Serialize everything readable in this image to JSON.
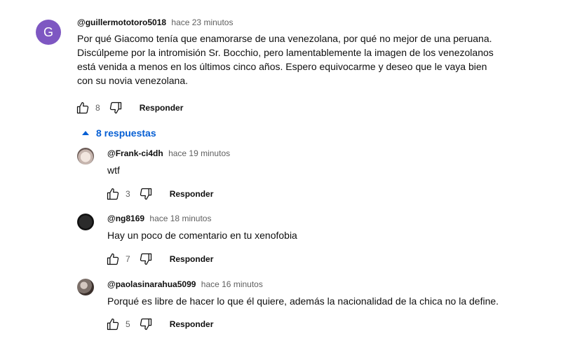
{
  "main_comment": {
    "avatar_letter": "G",
    "author": "@guillermototoro5018",
    "time": "hace 23 minutos",
    "text_lines": [
      "Por qué Giacomo tenía que enamorarse de una venezolana, por qué no mejor de una peruana.",
      "Discúlpeme por la intromisión Sr. Bocchio, pero lamentablemente la imagen de los venezolanos",
      "está venida a menos en los últimos cinco años.  Espero equivocarme y deseo que le vaya bien",
      "con su novia venezolana."
    ],
    "likes": "8",
    "reply_label": "Responder"
  },
  "replies_toggle": {
    "label": "8 respuestas"
  },
  "replies": [
    {
      "author": "@Frank-ci4dh",
      "time": "hace 19 minutos",
      "text": "wtf",
      "likes": "3",
      "reply_label": "Responder"
    },
    {
      "author": "@ng8169",
      "time": "hace 18 minutos",
      "text": "Hay un poco de comentario en tu xenofobia",
      "likes": "7",
      "reply_label": "Responder"
    },
    {
      "author": "@paolasinarahua5099",
      "time": "hace 16 minutos",
      "text": "Porqué es libre de hacer lo que él quiere, además la nacionalidad de la chica no la define.",
      "likes": "5",
      "reply_label": "Responder"
    }
  ],
  "icons": {
    "like": "thumbs-up-icon",
    "dislike": "thumbs-down-icon",
    "expand": "caret-up-icon"
  },
  "colors": {
    "avatar_bg": "#7e57c2",
    "link_blue": "#065fd4",
    "secondary_text": "#606060"
  }
}
